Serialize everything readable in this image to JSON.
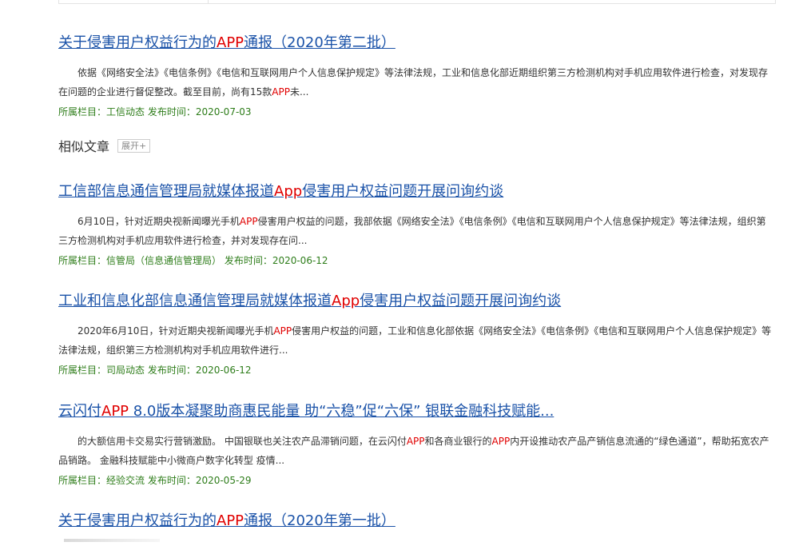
{
  "similar_section": {
    "label": "相似文章",
    "toggle": "展开+"
  },
  "results": [
    {
      "title": [
        "关于侵害用户权益行为的",
        "APP",
        "通报（2020年第二批）"
      ],
      "snippet": [
        "依据《网络安全法》《电信条例》《电信和互联网用户个人信息保护规定》等法律法规，工业和信息化部近期组织第三方检测机构对手机应用软件进行检查，对发现存在问题的企业进行督促整改。截至目前，尚有15款",
        "APP",
        "未..."
      ],
      "meta": "所属栏目：工信动态 发布时间：2020-07-03"
    },
    {
      "title": [
        "工信部信息通信管理局就媒体报道",
        "App",
        "侵害用户权益问题开展问询约谈"
      ],
      "snippet": [
        "6月10日，针对近期央视新闻曝光手机",
        "APP",
        "侵害用户权益的问题，我部依据《网络安全法》《电信条例》《电信和互联网用户个人信息保护规定》等法律法规，组织第三方检测机构对手机应用软件进行检查，并对发现存在问..."
      ],
      "meta": "所属栏目：信管局（信息通信管理局） 发布时间：2020-06-12"
    },
    {
      "title": [
        "工业和信息化部信息通信管理局就媒体报道",
        "App",
        "侵害用户权益问题开展问询约谈"
      ],
      "snippet": [
        "2020年6月10日，针对近期央视新闻曝光手机",
        "APP",
        "侵害用户权益的问题，工业和信息化部依据《网络安全法》《电信条例》《电信和互联网用户个人信息保护规定》等法律法规，组织第三方检测机构对手机应用软件进行..."
      ],
      "meta": "所属栏目：司局动态 发布时间：2020-06-12"
    },
    {
      "title": [
        "云闪付",
        "APP",
        " 8.0版本凝聚助商惠民能量 助“六稳”促“六保” 银联金融科技赋能..."
      ],
      "snippet": [
        "的大额信用卡交易实行营销激励。 中国银联也关注农产品滞销问题，在云闪付",
        "APP",
        "和各商业银行的",
        "APP",
        "内开设推动农产品产销信息流通的“绿色通道”，帮助拓宽农产品销路。 金融科技赋能中小微商户数字化转型 疫情..."
      ],
      "meta": "所属栏目：经验交流 发布时间：2020-05-29"
    },
    {
      "title": [
        "关于侵害用户权益行为的",
        "APP",
        "通报（2020年第一批）"
      ]
    }
  ]
}
